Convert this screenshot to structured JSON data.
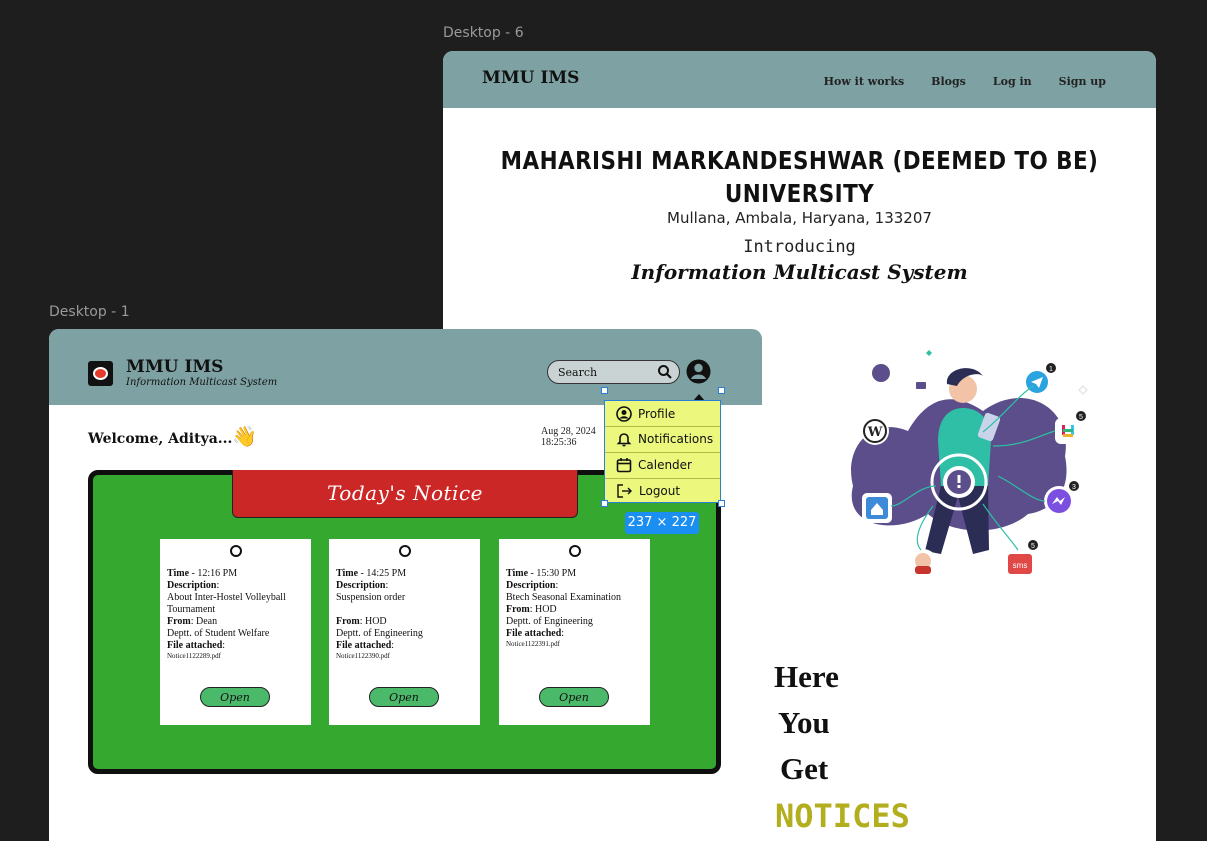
{
  "canvas": {
    "frame6_label": "Desktop - 6",
    "frame1_label": "Desktop - 1",
    "selection_size": "237 × 227"
  },
  "landing": {
    "brand": "MMU IMS",
    "nav": [
      "How it works",
      "Blogs",
      "Log in",
      "Sign up"
    ],
    "university_line1": "MAHARISHI MARKANDESHWAR (DEEMED TO BE)",
    "university_line2": "UNIVERSITY",
    "address": "Mullana, Ambala, Haryana, 133207",
    "introducing": "Introducing",
    "system_name": "Information Multicast System",
    "tagline": [
      "Here",
      "You",
      "Get",
      "NOTICES"
    ],
    "badges": {
      "telegram": "1",
      "slack": "5",
      "messenger": "3",
      "sms": "5",
      "sms_label": "sms"
    }
  },
  "dashboard": {
    "brand": "MMU IMS",
    "subbrand": "Information Multicast System",
    "search_placeholder": "Search",
    "welcome": "Welcome, Aditya...",
    "wave": "👋",
    "date": "Aug 28, 2024",
    "time": "18:25:36",
    "board_title": "Today's Notice",
    "menu": [
      "Profile",
      "Notifications",
      "Calender",
      "Logout"
    ],
    "open_label": "Open",
    "notices": [
      {
        "time": "12:16 PM",
        "description": "About Inter-Hostel Volleyball Tournament",
        "from_role": "Dean",
        "from_dept": "Deptt. of Student Welfare",
        "file": "Notice1122289.pdf"
      },
      {
        "time": "14:25 PM",
        "description": "Suspension order",
        "from_role": "HOD",
        "from_dept": "Deptt. of Engineering",
        "file": "Notice1122390.pdf"
      },
      {
        "time": "15:30 PM",
        "description": "Btech Seasonal Examination",
        "from_role": "HOD",
        "from_dept": "Deptt. of Engineering",
        "file": "Notice1122391.pdf"
      }
    ],
    "labels": {
      "time": "Time",
      "description": "Description",
      "from": "From",
      "file": "File attached"
    }
  }
}
